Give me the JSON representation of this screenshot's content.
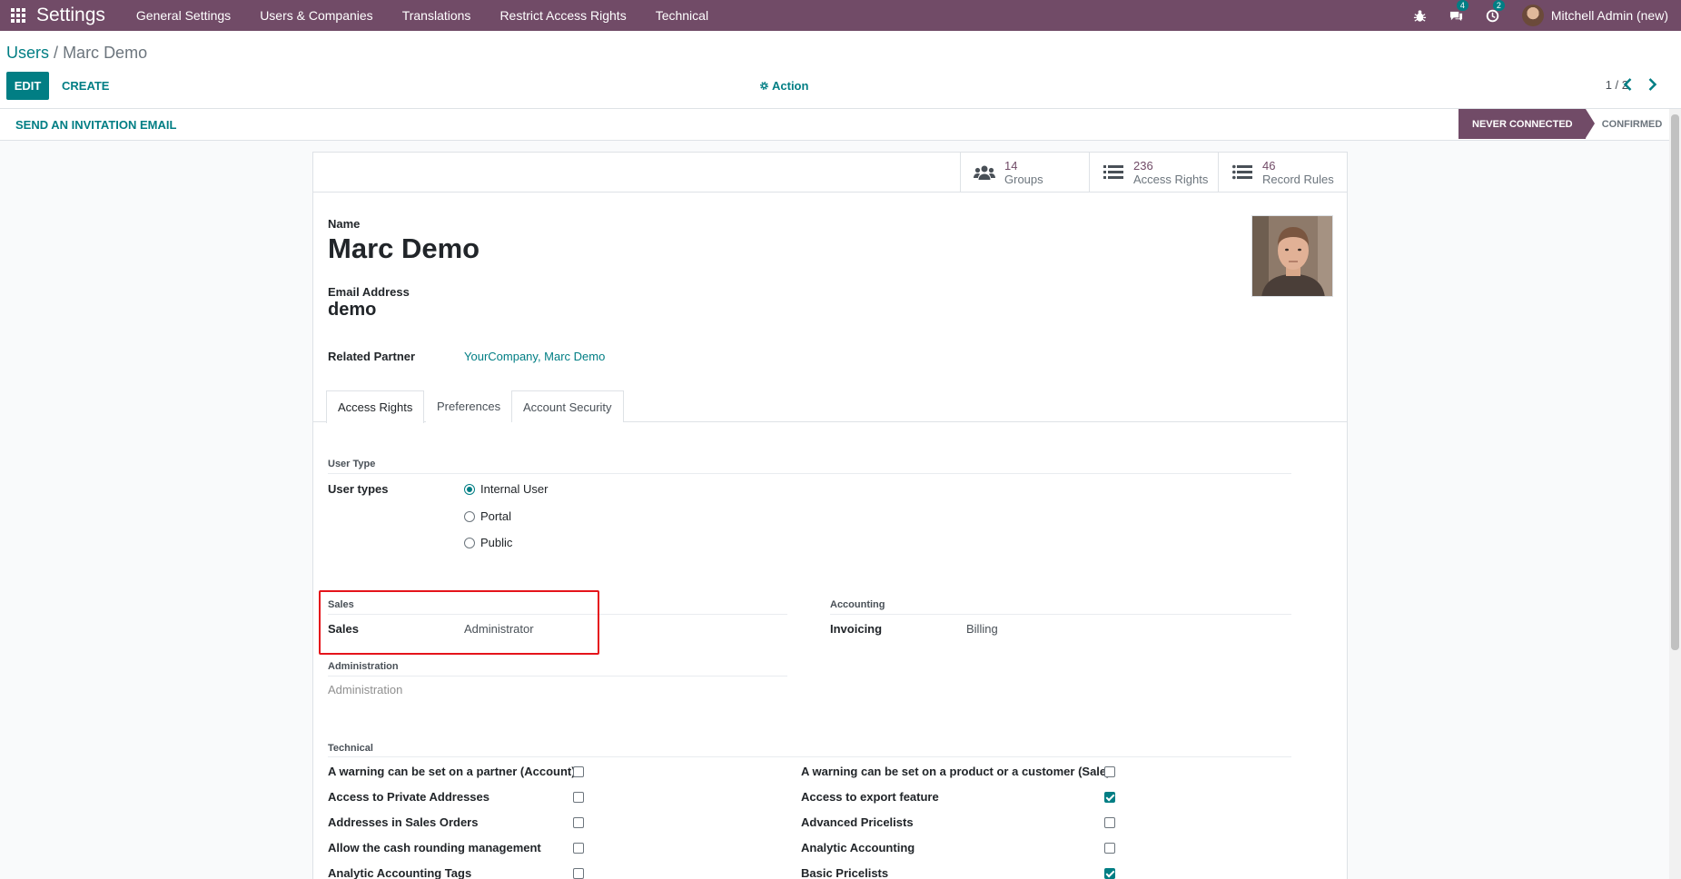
{
  "navbar": {
    "brand": "Settings",
    "menu": [
      "General Settings",
      "Users & Companies",
      "Translations",
      "Restrict Access Rights",
      "Technical"
    ],
    "messages_badge": "4",
    "activities_badge": "2",
    "user_name": "Mitchell Admin (new)"
  },
  "breadcrumb": {
    "parent": "Users",
    "separator": "/",
    "current": "Marc Demo"
  },
  "buttons": {
    "edit": "EDIT",
    "create": "CREATE",
    "action": "Action",
    "invite": "SEND AN INVITATION EMAIL"
  },
  "pager": {
    "value": "1 / 2"
  },
  "status": {
    "active": "NEVER CONNECTED",
    "next": "CONFIRMED"
  },
  "smart_buttons": [
    {
      "value": "14",
      "label": "Groups",
      "icon": "users-icon"
    },
    {
      "value": "236",
      "label": "Access Rights",
      "icon": "list-icon"
    },
    {
      "value": "46",
      "label": "Record Rules",
      "icon": "list-icon"
    }
  ],
  "form": {
    "name_label": "Name",
    "name": "Marc Demo",
    "email_label": "Email Address",
    "email": "demo",
    "partner_label": "Related Partner",
    "partner": "YourCompany, Marc Demo"
  },
  "tabs": [
    "Access Rights",
    "Preferences",
    "Account Security"
  ],
  "user_type": {
    "title": "User Type",
    "label": "User types",
    "options": [
      {
        "label": "Internal User",
        "checked": true
      },
      {
        "label": "Portal",
        "checked": false
      },
      {
        "label": "Public",
        "checked": false
      }
    ]
  },
  "sales": {
    "title": "Sales",
    "label": "Sales",
    "value": "Administrator"
  },
  "accounting": {
    "title": "Accounting",
    "label": "Invoicing",
    "value": "Billing"
  },
  "administration": {
    "title": "Administration",
    "value": "Administration"
  },
  "technical": {
    "title": "Technical",
    "left": [
      {
        "label": "A warning can be set on a partner (Account)",
        "checked": false
      },
      {
        "label": "Access to Private Addresses",
        "checked": false
      },
      {
        "label": "Addresses in Sales Orders",
        "checked": false
      },
      {
        "label": "Allow the cash rounding management",
        "checked": false
      },
      {
        "label": "Analytic Accounting Tags",
        "checked": false
      }
    ],
    "right": [
      {
        "label": "A warning can be set on a product or a customer (Sale)",
        "checked": false
      },
      {
        "label": "Access to export feature",
        "checked": true
      },
      {
        "label": "Advanced Pricelists",
        "checked": false
      },
      {
        "label": "Analytic Accounting",
        "checked": false
      },
      {
        "label": "Basic Pricelists",
        "checked": true
      }
    ]
  },
  "colors": {
    "brand": "#714b67",
    "accent": "#017e84",
    "highlight": "#e5141b"
  }
}
